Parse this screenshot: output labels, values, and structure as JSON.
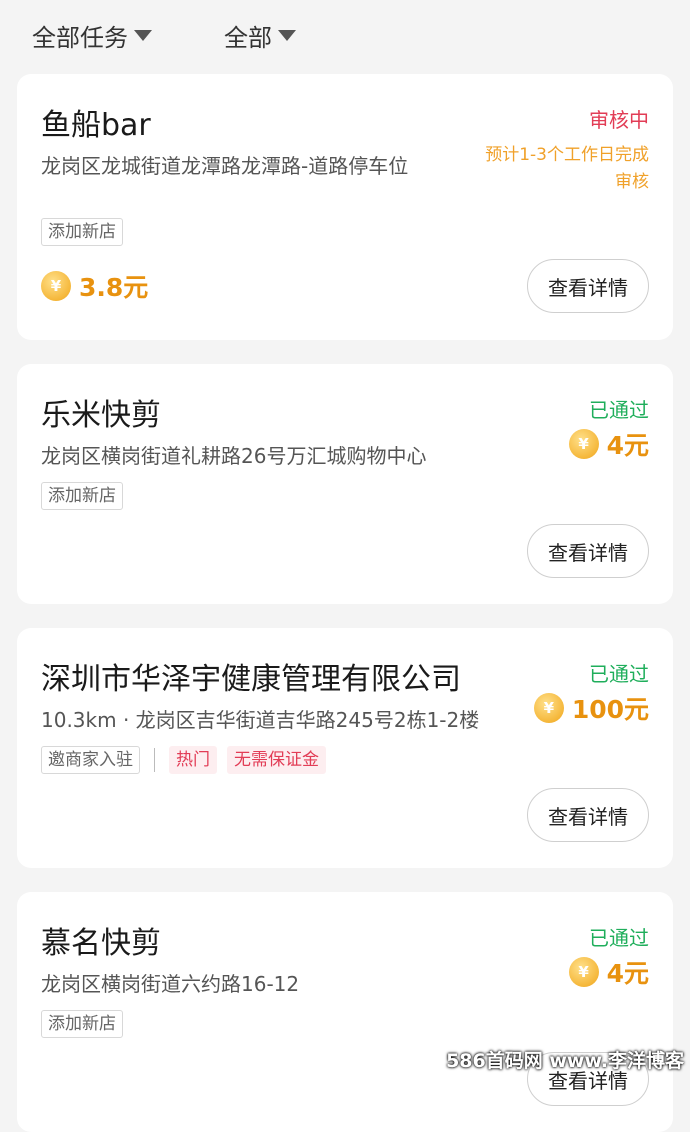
{
  "filters": [
    {
      "label": "全部任务"
    },
    {
      "label": "全部"
    }
  ],
  "cards": [
    {
      "title": "鱼船bar",
      "address": "龙岗区龙城街道龙潭路龙潭路-道路停车位",
      "tags": [
        "添加新店"
      ],
      "status": "审核中",
      "note": "预计1-3个工作日完成审核",
      "reward": "3.8元",
      "button": "查看详情"
    },
    {
      "title": "乐米快剪",
      "address": "龙岗区横岗街道礼耕路26号万汇城购物中心",
      "tags": [
        "添加新店"
      ],
      "status": "已通过",
      "reward": "4元",
      "button": "查看详情"
    },
    {
      "title": "深圳市华泽宇健康管理有限公司",
      "address": "10.3km · 龙岗区吉华街道吉华路245号2栋1-2楼",
      "tags": [
        "邀商家入驻"
      ],
      "hot_tags": [
        "热门",
        "无需保证金"
      ],
      "status": "已通过",
      "reward": "100元",
      "button": "查看详情"
    },
    {
      "title": "慕名快剪",
      "address": "龙岗区横岗街道六约路16-12",
      "tags": [
        "添加新店"
      ],
      "status": "已通过",
      "reward": "4元",
      "button": "查看详情"
    }
  ],
  "coin_symbol": "¥",
  "watermark": "586首码网 www.李洋博客",
  "colors": {
    "review": "#e23d56",
    "passed": "#1fae5b",
    "reward": "#e8920f",
    "note": "#f0a12a"
  },
  "icons": {
    "filter_caret": "caret-down-icon",
    "coin": "coin-icon"
  }
}
